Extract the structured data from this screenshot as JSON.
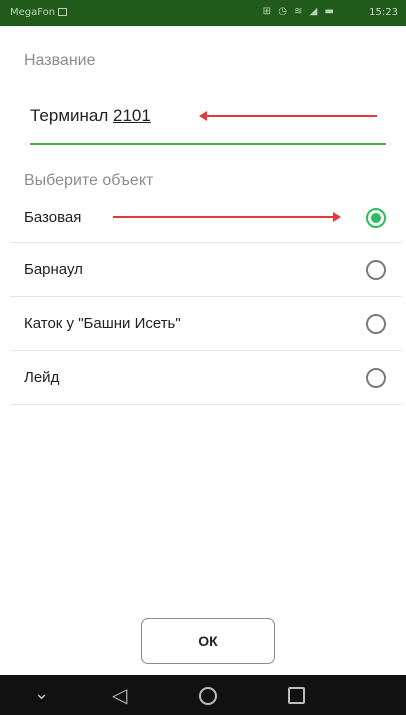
{
  "status_bar": {
    "carrier": "MegaFon",
    "icons": "⊞ ◷ ≋ ◢ ▬",
    "time": "15:23"
  },
  "form": {
    "name_label": "Название",
    "name_value_prefix": "Терминал ",
    "name_value_number": "2101",
    "object_label": "Выберите объект"
  },
  "objects": [
    {
      "label": "Базовая",
      "selected": true
    },
    {
      "label": "Барнаул",
      "selected": false
    },
    {
      "label": "Каток у \"Башни Исеть\"",
      "selected": false
    },
    {
      "label": "Лейд",
      "selected": false
    }
  ],
  "ok_button": {
    "label": "ОК"
  },
  "nav_bar": {
    "down_icon": "chevron-down-icon",
    "back_icon": "back-icon",
    "home_icon": "home-icon",
    "recent_icon": "recent-apps-icon"
  },
  "colors": {
    "status_bar": "#215b1b",
    "accent_green": "#4caf50",
    "radio_selected": "#2ebd5a",
    "annotation_arrow": "#e03a3a",
    "nav_bar": "#111111"
  }
}
